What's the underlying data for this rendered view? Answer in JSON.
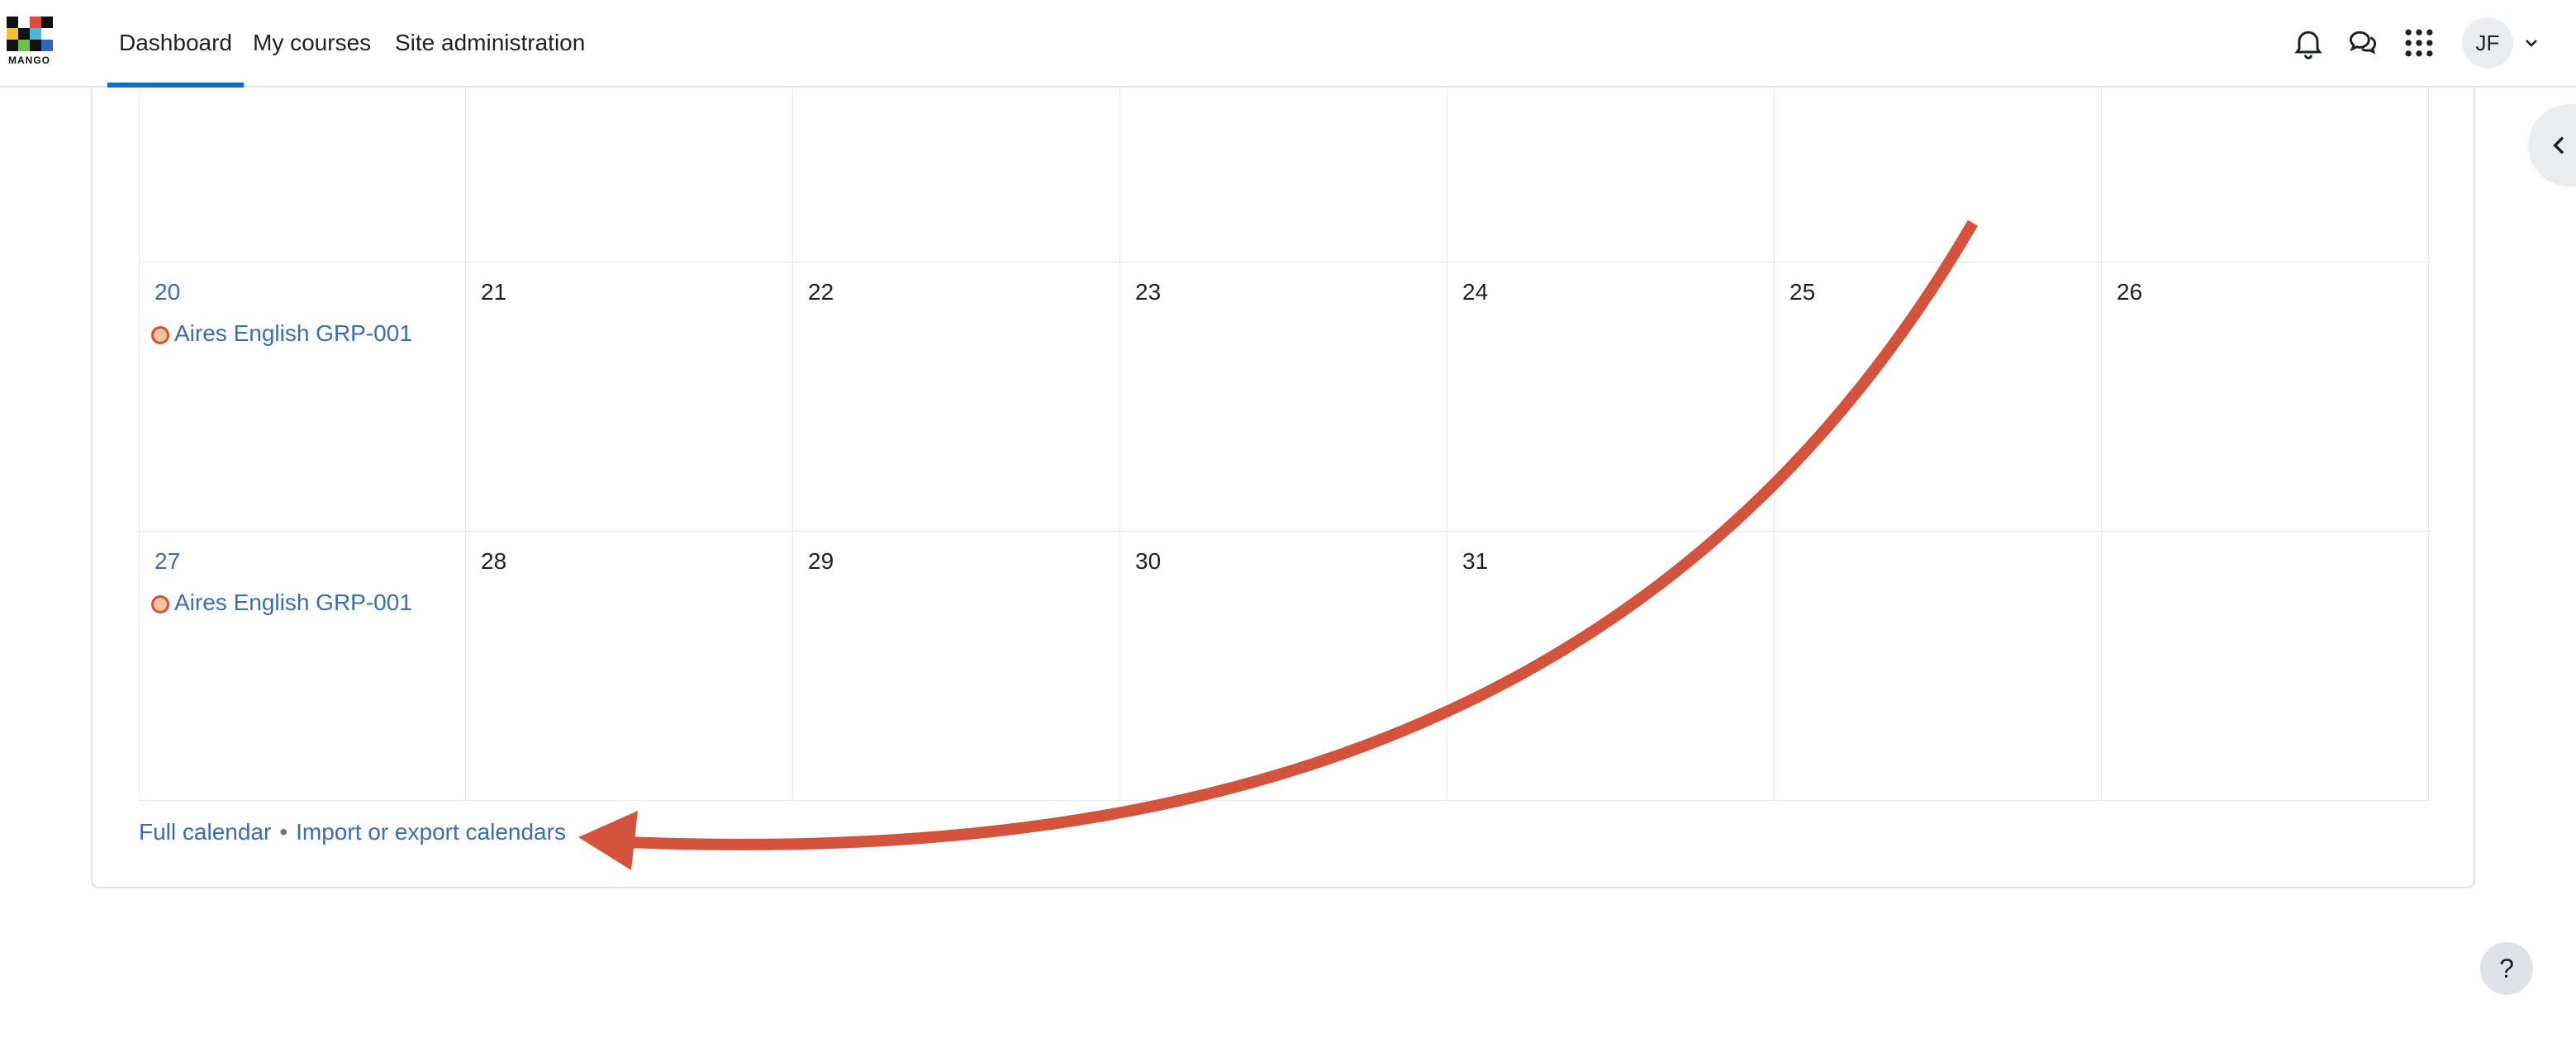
{
  "brand": {
    "logo_text": "MANGO"
  },
  "nav": {
    "items": [
      {
        "label": "Dashboard",
        "active": true
      },
      {
        "label": "My courses",
        "active": false
      },
      {
        "label": "Site administration",
        "active": false
      }
    ],
    "icons": [
      "bell-icon",
      "chat-icon",
      "apps-grid-icon"
    ],
    "user_initials": "JF"
  },
  "calendar": {
    "rows": [
      {
        "days": [
          "",
          "",
          "",
          "",
          "",
          "",
          ""
        ]
      },
      {
        "days": [
          "20",
          "21",
          "22",
          "23",
          "24",
          "25",
          "26"
        ],
        "event": {
          "day_index": 0,
          "label": "Aires English GRP-001"
        }
      },
      {
        "days": [
          "27",
          "28",
          "29",
          "30",
          "31",
          "",
          ""
        ],
        "event": {
          "day_index": 0,
          "label": "Aires English GRP-001"
        }
      }
    ],
    "event_color": "#d4532e"
  },
  "footer": {
    "full_calendar": "Full calendar",
    "separator": "•",
    "import_export": "Import or export calendars"
  },
  "help": {
    "label": "?"
  },
  "colors": {
    "accent": "#0f6cbf",
    "link": "#3a6bb5",
    "annotation_arrow": "#d4533c"
  }
}
